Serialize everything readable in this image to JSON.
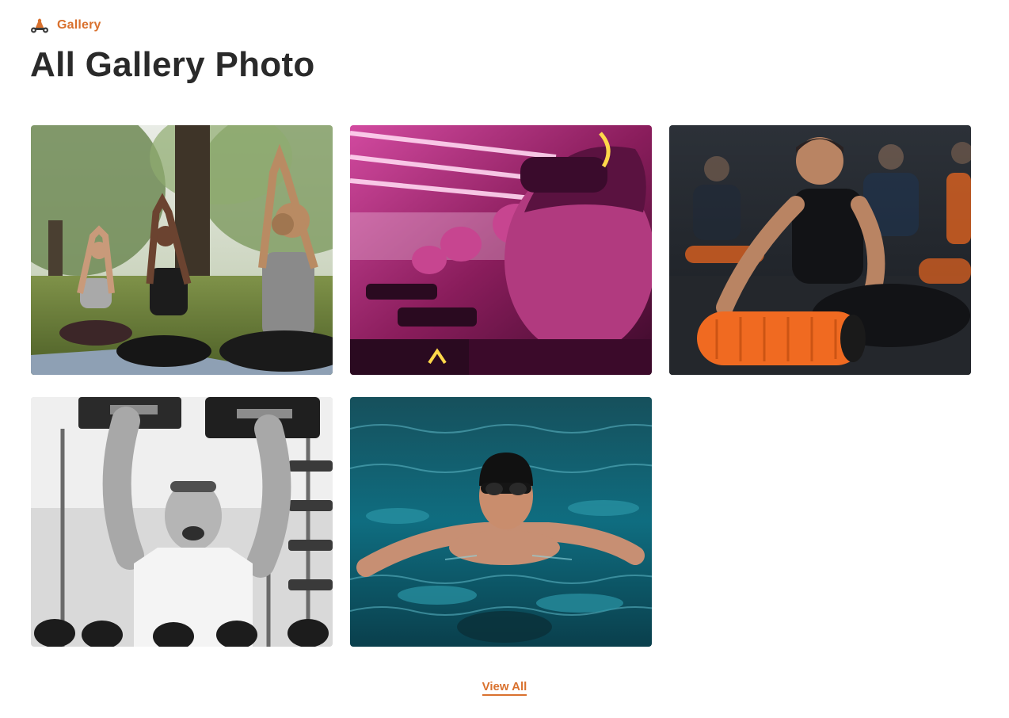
{
  "section": {
    "eyebrow_label": "Gallery",
    "eyebrow_icon": "dumbbell-logo-icon",
    "title": "All Gallery Photo"
  },
  "gallery": {
    "photos": [
      {
        "subject": "yoga-in-park"
      },
      {
        "subject": "vr-cycling-class"
      },
      {
        "subject": "foam-roller-stretch"
      },
      {
        "subject": "dumbbell-overhead-press"
      },
      {
        "subject": "swimmer-in-pool"
      }
    ]
  },
  "footer": {
    "view_all_label": "View All"
  },
  "colors": {
    "accent": "#d9712e",
    "title": "#2a2a2a",
    "background": "#ffffff"
  }
}
